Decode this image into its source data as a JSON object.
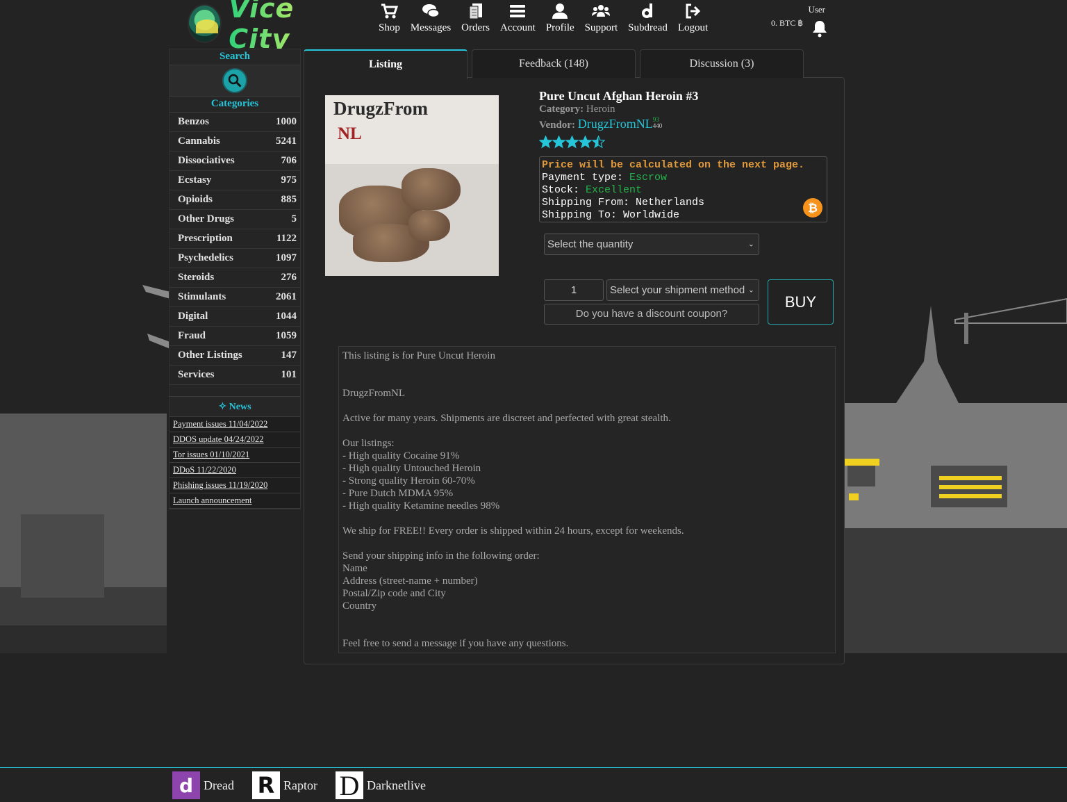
{
  "brand": {
    "name": "Vice City"
  },
  "nav": [
    {
      "label": "Shop",
      "icon": "cart-icon"
    },
    {
      "label": "Messages",
      "icon": "chat-icon"
    },
    {
      "label": "Orders",
      "icon": "receipt-icon"
    },
    {
      "label": "Account",
      "icon": "menu-icon"
    },
    {
      "label": "Profile",
      "icon": "user-icon"
    },
    {
      "label": "Support",
      "icon": "users-icon"
    },
    {
      "label": "Subdread",
      "icon": "dread-icon"
    },
    {
      "label": "Logout",
      "icon": "logout-icon"
    }
  ],
  "user": {
    "name": "User",
    "balance": "0. BTC ฿"
  },
  "sidebar": {
    "search_title": "Search",
    "categories_title": "Categories",
    "categories": [
      {
        "name": "Benzos",
        "count": "1000"
      },
      {
        "name": "Cannabis",
        "count": "5241"
      },
      {
        "name": "Dissociatives",
        "count": "706"
      },
      {
        "name": "Ecstasy",
        "count": "975"
      },
      {
        "name": "Opioids",
        "count": "885"
      },
      {
        "name": "Other Drugs",
        "count": "5"
      },
      {
        "name": "Prescription",
        "count": "1122"
      },
      {
        "name": "Psychedelics",
        "count": "1097"
      },
      {
        "name": "Steroids",
        "count": "276"
      },
      {
        "name": "Stimulants",
        "count": "2061"
      },
      {
        "name": "Digital",
        "count": "1044"
      },
      {
        "name": "Fraud",
        "count": "1059"
      },
      {
        "name": "Other Listings",
        "count": "147"
      },
      {
        "name": "Services",
        "count": "101"
      }
    ],
    "news_title": "News",
    "news": [
      "Payment issues 11/04/2022",
      "DDOS update 04/24/2022",
      "Tor issues 01/10/2021",
      "DDoS 11/22/2020",
      "Phishing issues 11/19/2020",
      "Launch announcement"
    ]
  },
  "tabs": [
    {
      "label": "Listing",
      "active": true
    },
    {
      "label": "Feedback (148)",
      "active": false
    },
    {
      "label": "Discussion (3)",
      "active": false
    }
  ],
  "listing": {
    "image_text_1": "DrugzFrom",
    "image_text_2": "NL",
    "title": "Pure Uncut Afghan Heroin #3",
    "category_label": "Category:",
    "category": "Heroin",
    "vendor_label": "Vendor:",
    "vendor": "DrugzFromNL",
    "vendor_score_top": "93",
    "vendor_score_bottom": "440",
    "rating": 4.5,
    "rating_max": 5,
    "price_note": "Price will be calculated on the next page.",
    "payment_label": "Payment type:",
    "payment": "Escrow",
    "stock_label": "Stock:",
    "stock": "Excellent",
    "ship_from_label": "Shipping From:",
    "ship_from": "Netherlands",
    "ship_to_label": "Shipping To:",
    "ship_to": "Worldwide",
    "quantity_select": "Select the quantity",
    "quantity_value": "1",
    "shipment_select": "Select your shipment method",
    "coupon_placeholder": "Do you have a discount coupon?",
    "buy_label": "BUY",
    "description": "This listing is for Pure Uncut Heroin\n\n\nDrugzFromNL\n\nActive for many years. Shipments are discreet and perfected with great stealth.\n\nOur listings:\n- High quality Cocaine 91%\n- High quality Untouched Heroin\n- Strong quality Heroin 60-70%\n- Pure Dutch MDMA 95%\n- High quality Ketamine needles 98%\n\nWe ship for FREE!! Every order is shipped within 24 hours, except for weekends.\n\nSend your shipping info in the following order:\nName\nAddress (street-name + number)\nPostal/Zip code and City\nCountry\n\n\nFeel free to send a message if you have any questions."
  },
  "footer": [
    {
      "label": "Dread",
      "glyph": "d"
    },
    {
      "label": "Raptor",
      "glyph": "R"
    },
    {
      "label": "Darknetlive",
      "glyph": "D"
    }
  ],
  "colors": {
    "accent": "#26c6da",
    "price_note": "#e09a3b",
    "green": "#24b24a"
  }
}
